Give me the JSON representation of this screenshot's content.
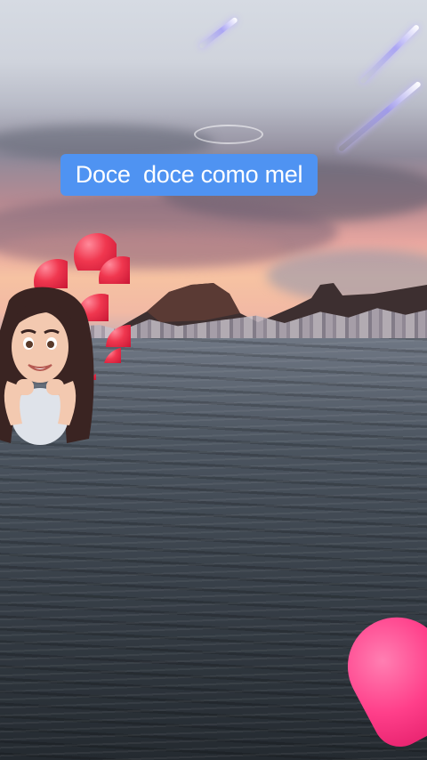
{
  "caption": {
    "text": "Doce  doce como mel"
  },
  "scene": {
    "description_icon": "sunset-sea-photo"
  },
  "stickers": {
    "avatar_icon": "girl-avatar-icon",
    "heart_icon": "heart-icon",
    "shooting_star_icon": "shooting-star-icon"
  },
  "colors": {
    "caption_bg": "#4f93f2",
    "caption_text": "#ffffff",
    "heart": "#f0374f",
    "big_heart": "#ff3f8a"
  }
}
